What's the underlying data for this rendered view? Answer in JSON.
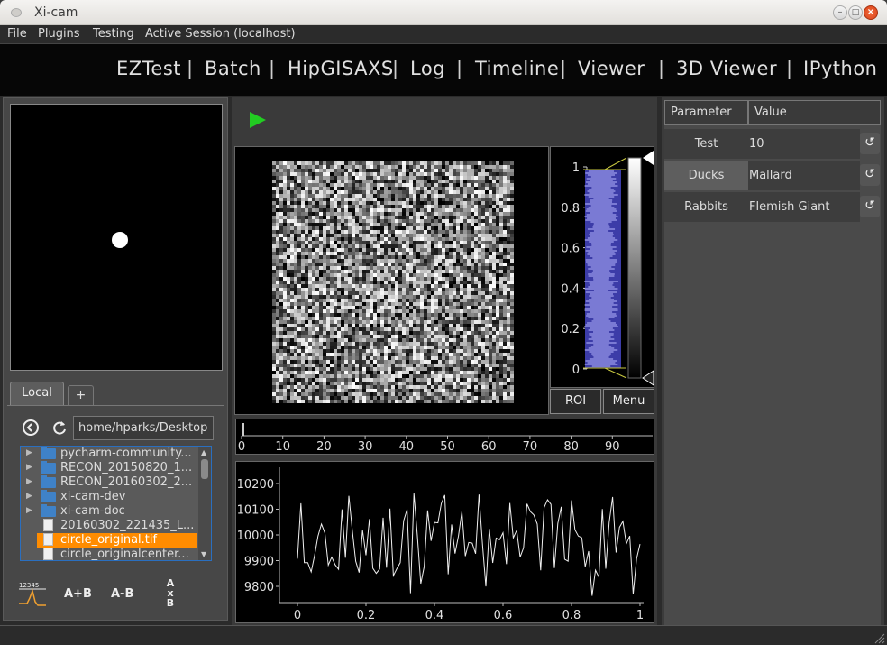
{
  "window": {
    "title": "Xi-cam"
  },
  "menu": [
    "File",
    "Plugins",
    "Testing",
    "Active Session (localhost)"
  ],
  "modes": [
    "EZTest",
    "Batch",
    "HipGISAXS",
    "Log",
    "Timeline",
    "Viewer",
    "3D Viewer",
    "IPython"
  ],
  "browser": {
    "tabs": [
      {
        "label": "Local"
      },
      {
        "label": "+"
      }
    ],
    "path": "home/hparks/Desktop",
    "items": [
      {
        "name": "pycharm-community...",
        "type": "folder"
      },
      {
        "name": "RECON_20150820_1...",
        "type": "folder"
      },
      {
        "name": "RECON_20160302_2...",
        "type": "folder"
      },
      {
        "name": "xi-cam-dev",
        "type": "folder"
      },
      {
        "name": "xi-cam-doc",
        "type": "folder"
      },
      {
        "name": "20160302_221435_L...",
        "type": "file"
      },
      {
        "name": "circle_original.tif",
        "type": "file",
        "selected": true
      },
      {
        "name": "circle_originalcenter...",
        "type": "file"
      }
    ],
    "ops": [
      "A+B",
      "A-B",
      "A x B"
    ],
    "op_icon_digits": "12345"
  },
  "histogram": {
    "ticks": [
      "1",
      "0.8",
      "0.6",
      "0.4",
      "0.2",
      "0"
    ],
    "buttons": [
      "ROI",
      "Menu"
    ]
  },
  "timeline": {
    "ticks": [
      "0",
      "10",
      "20",
      "30",
      "40",
      "50",
      "60",
      "70",
      "80",
      "90"
    ]
  },
  "lineplot": {
    "yticks": [
      "10200",
      "10100",
      "10000",
      "9900",
      "9800"
    ],
    "xticks": [
      "0",
      "0.2",
      "0.4",
      "0.6",
      "0.8",
      "1"
    ]
  },
  "parameters": {
    "headers": [
      "Parameter",
      "Value"
    ],
    "rows": [
      {
        "name": "Test",
        "value": "10"
      },
      {
        "name": "Ducks",
        "value": "Mallard"
      },
      {
        "name": "Rabbits",
        "value": "Flemish Giant"
      }
    ]
  },
  "colors": {
    "accent": "#ff8c00",
    "play": "#22cc22",
    "histogram": "#3c3ca8"
  }
}
